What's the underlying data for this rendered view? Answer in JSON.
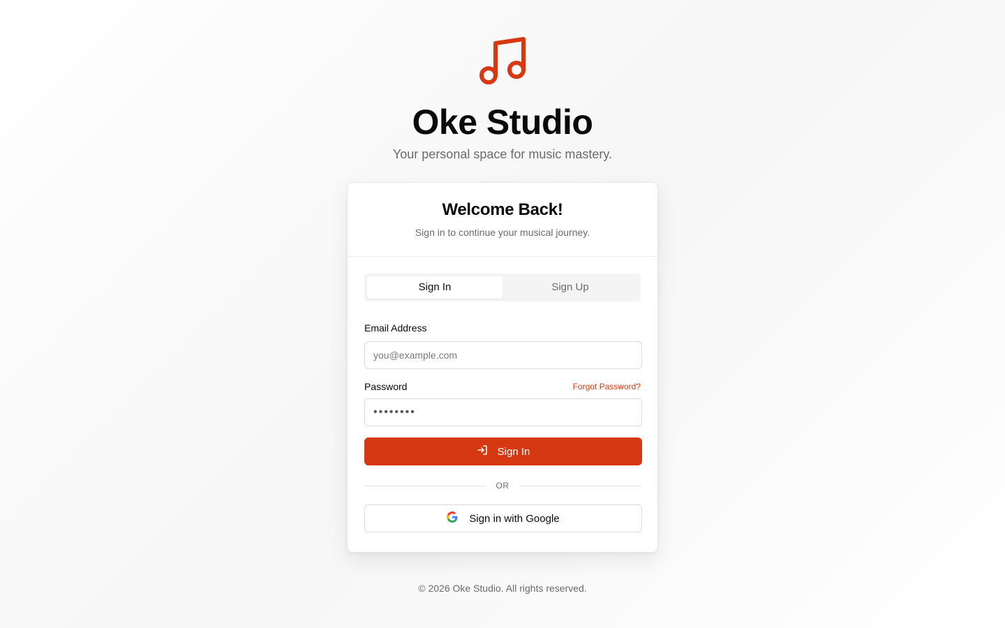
{
  "brand": {
    "logo_icon": "music-note-icon",
    "title": "Oke Studio",
    "subtitle": "Your personal space for music mastery."
  },
  "colors": {
    "accent": "#d63811",
    "text": "#0a0a0a",
    "muted": "#6b6b6b"
  },
  "card": {
    "title": "Welcome Back!",
    "subtitle": "Sign in to continue your musical journey.",
    "tabs": [
      {
        "label": "Sign In",
        "active": true
      },
      {
        "label": "Sign Up",
        "active": false
      }
    ],
    "email": {
      "label": "Email Address",
      "placeholder": "you@example.com",
      "value": ""
    },
    "password": {
      "label": "Password",
      "value": "••••••••",
      "forgot_label": "Forgot Password?"
    },
    "submit": {
      "label": "Sign In",
      "icon": "sign-in-icon"
    },
    "divider_text": "OR",
    "google": {
      "label": "Sign in with Google",
      "icon": "google-icon"
    }
  },
  "footer": "© 2026 Oke Studio. All rights reserved."
}
